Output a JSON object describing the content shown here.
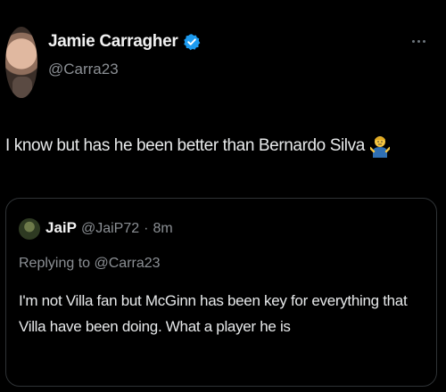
{
  "author": {
    "name": "Jamie Carragher",
    "handle": "@Carra23",
    "avatar_icon": "profile-photo",
    "verified_color": "#1d9bf0"
  },
  "tweet": {
    "text": "I know but has he been better than Bernardo Silva",
    "emoji": "person-shrugging-emoji"
  },
  "quoted": {
    "name": "JaiP",
    "handle": "@JaiP72",
    "separator": "·",
    "time": "8m",
    "replying_to": "Replying to @Carra23",
    "text": "I'm not Villa fan but McGinn has been key for everything that Villa have been doing. What a player he is"
  },
  "colors": {
    "background": "#000000",
    "text": "#e7e9ea",
    "secondary_text": "#8b8f94",
    "border": "#2f3336"
  }
}
